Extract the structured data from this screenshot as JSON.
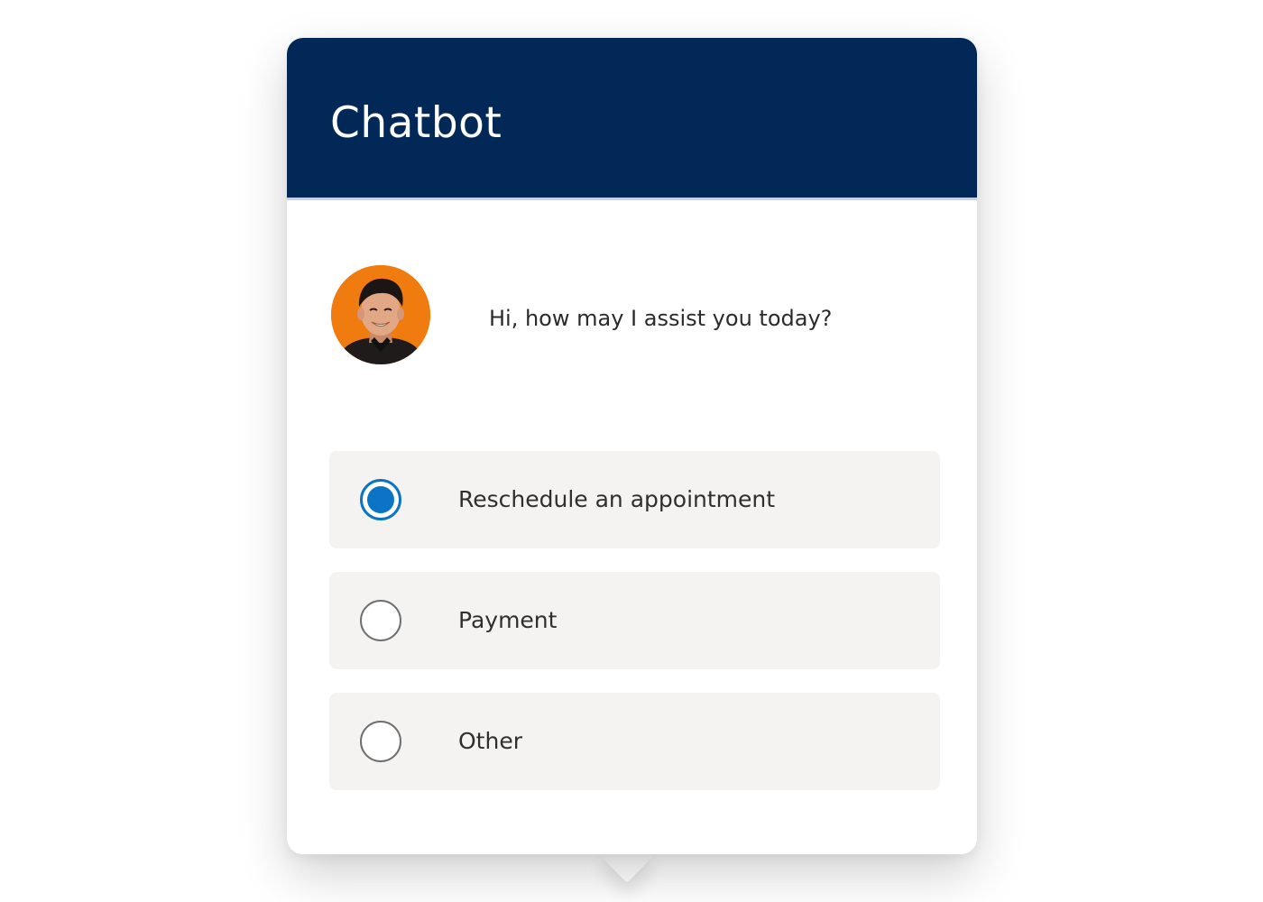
{
  "chatbot": {
    "title": "Chatbot",
    "header_color": "#012856",
    "accent_color": "#0b74c4",
    "avatar": {
      "icon": "agent-avatar-photo",
      "background_color": "#f07b0f"
    },
    "message": "Hi, how may I assist you today?",
    "options": [
      {
        "label": "Reschedule an appointment",
        "selected": true
      },
      {
        "label": "Payment",
        "selected": false
      },
      {
        "label": "Other",
        "selected": false
      }
    ]
  }
}
